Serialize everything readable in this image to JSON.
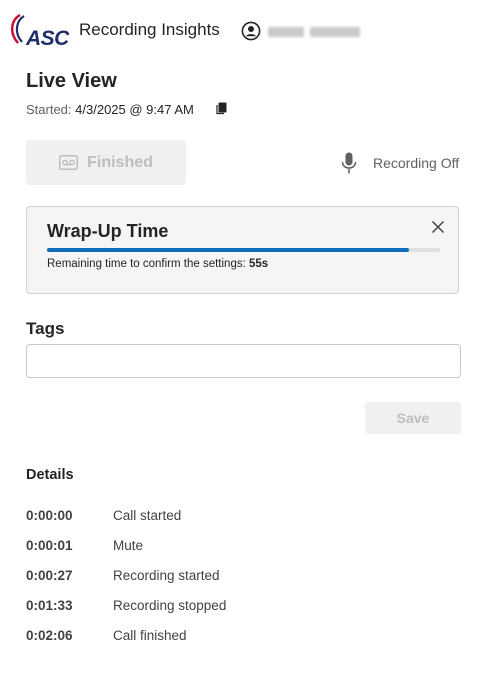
{
  "header": {
    "logo_text": "ASC",
    "app_title": "Recording Insights",
    "user_icon": "user-circle-icon",
    "user_name_blurred": true
  },
  "main": {
    "title": "Live View",
    "started_label": "Started:",
    "started_value": "4/3/2025 @ 9:47 AM",
    "finished_button_label": "Finished",
    "recording_status": "Recording Off"
  },
  "wrapup": {
    "title": "Wrap-Up Time",
    "progress": 0.92,
    "message": "Remaining time to confirm the settings:",
    "remaining": "55s"
  },
  "tags": {
    "label": "Tags",
    "value": "",
    "placeholder": ""
  },
  "save_label": "Save",
  "details": {
    "label": "Details",
    "rows": [
      {
        "time": "0:00:00",
        "event": "Call started"
      },
      {
        "time": "0:00:01",
        "event": "Mute"
      },
      {
        "time": "0:00:27",
        "event": "Recording started"
      },
      {
        "time": "0:01:33",
        "event": "Recording stopped"
      },
      {
        "time": "0:02:06",
        "event": "Call finished"
      }
    ]
  },
  "colors": {
    "accent": "#0f6cbd",
    "brand_navy": "#1f2d6b",
    "brand_red": "#c8102e",
    "disabled_bg": "#f0f0f0",
    "disabled_text": "#bdbdbd"
  }
}
